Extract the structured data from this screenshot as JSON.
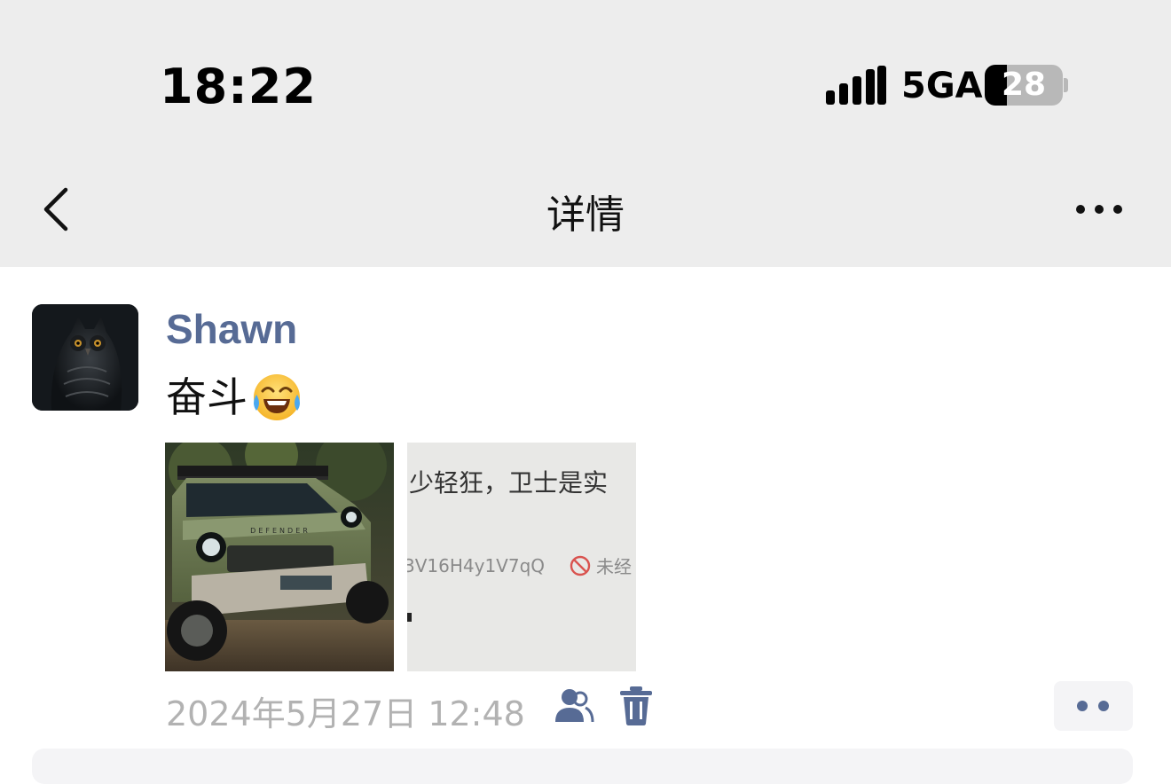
{
  "status_bar": {
    "time": "18:22",
    "network": "5GA",
    "battery_level": "28",
    "battery_percent": 28,
    "signal_icon": "signal-bars-icon"
  },
  "nav": {
    "title": "详情",
    "back_icon": "chevron-left-icon",
    "more_icon": "more-dots-icon"
  },
  "post": {
    "author": "Shawn",
    "text": "奋斗",
    "emoji": "tears-of-joy-emoji",
    "photos": [
      {
        "subject": "green off-road SUV photo",
        "badge_text": "DEFENDER"
      },
      {
        "subject": "screenshot of text",
        "line1": "少轻狂，卫士是实",
        "line2_code": "3V16H4y1V7qQ",
        "line2_note": "未经"
      }
    ],
    "timestamp": "2024年5月27日 12:48",
    "visibility_icon": "friends-visibility-icon",
    "delete_icon": "trash-icon",
    "action_icon": "two-dots-icon"
  },
  "colors": {
    "bar_background": "#ededed",
    "author_link": "#576b95",
    "timestamp": "#b2b2b2",
    "background": "#ffffff"
  }
}
